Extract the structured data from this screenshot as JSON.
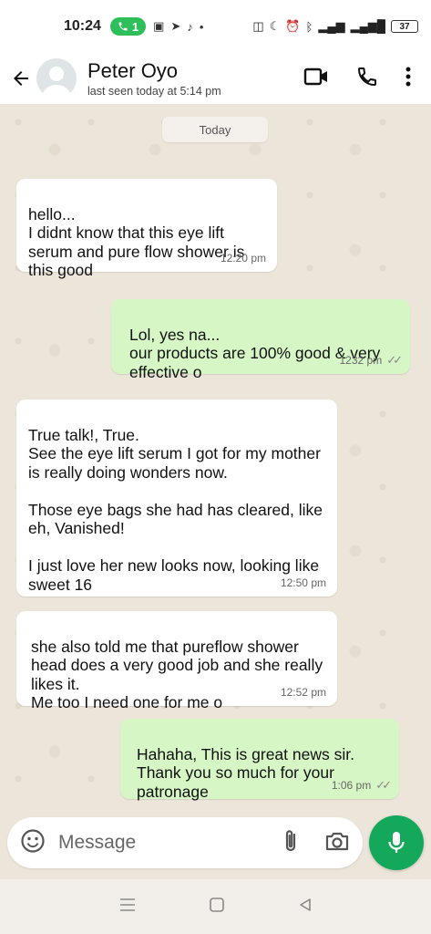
{
  "status_bar": {
    "time": "10:24",
    "call_count": "1",
    "battery": "37"
  },
  "header": {
    "contact_name": "Peter Oyo",
    "last_seen": "last seen today at 5:14 pm",
    "icons": [
      "back-arrow-icon",
      "avatar",
      "video-call-icon",
      "phone-icon",
      "more-vert-icon"
    ]
  },
  "chat": {
    "date_chip": "Today",
    "messages": [
      {
        "direction": "in",
        "text": "hello...\nI didnt know that this eye lift serum and pure flow shower is this good",
        "time": "12:20 pm"
      },
      {
        "direction": "out",
        "text": "Lol, yes na...\nour products are 100% good & very effective o",
        "time": "1232 pm",
        "status": "read"
      },
      {
        "direction": "in",
        "text": "True talk!, True.\nSee the eye lift serum I got for my mother is really doing wonders now.\n\nThose eye bags she had has cleared, like eh, Vanished!\n\nI just love her new looks now, looking like sweet 16",
        "time": "12:50 pm"
      },
      {
        "direction": "in",
        "text": "she also told me that pureflow shower head does a very good job and she really likes it.\nMe too I need one for me o",
        "time": "12:52 pm"
      },
      {
        "direction": "out",
        "text": "Hahaha, This is great news sir.\nThank you so much for your patronage",
        "time": "1:06 pm",
        "status": "read"
      }
    ]
  },
  "composer": {
    "placeholder": "Message"
  },
  "colors": {
    "outgoing_bubble": "#d6f7c5",
    "incoming_bubble": "#ffffff",
    "mic_button": "#14a85a",
    "call_pill": "#2fbf5a"
  }
}
